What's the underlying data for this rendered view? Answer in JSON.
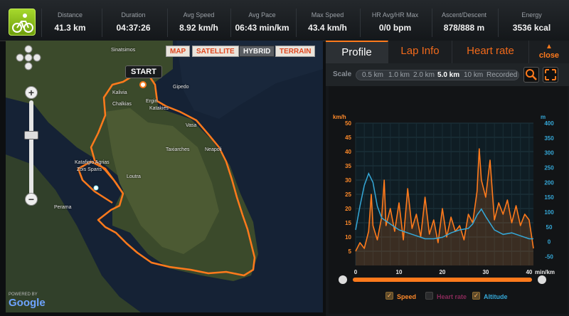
{
  "stats": [
    {
      "label": "Distance",
      "value": "41.3 km"
    },
    {
      "label": "Duration",
      "value": "04:37:26"
    },
    {
      "label": "Avg Speed",
      "value": "8.92 km/h"
    },
    {
      "label": "Avg Pace",
      "value": "06:43 min/km"
    },
    {
      "label": "Max Speed",
      "value": "43.4 km/h"
    },
    {
      "label": "HR Avg/HR Max",
      "value": "0/0 bpm"
    },
    {
      "label": "Ascent/Descent",
      "value": "878/888 m"
    },
    {
      "label": "Energy",
      "value": "3536 kcal"
    }
  ],
  "map": {
    "types": [
      "MAP",
      "SATELLITE",
      "HYBRID",
      "TERRAIN"
    ],
    "selected_type": "HYBRID",
    "start_label": "START",
    "place_labels": [
      "Sinatsimos",
      "Kalivia",
      "Chalkias",
      "Gipedo",
      "Ergin",
      "Katakies",
      "Vasa",
      "Taxiarches",
      "Neapoli",
      "Katafigio Agrias",
      "Zois Sparis",
      "Loutra",
      "Perama"
    ],
    "powered_by": "POWERED BY",
    "logo": "Google",
    "route_color": "#ff7a1c"
  },
  "panel": {
    "tabs": [
      "Profile",
      "Lap Info",
      "Heart rate"
    ],
    "active_tab": "Profile",
    "close_label": "close",
    "scale_label": "Scale",
    "scale_options": [
      "0.5 km",
      "1.0 km",
      "2.0 km",
      "5.0 km",
      "10 km",
      "Recorded"
    ],
    "selected_scale": "5.0 km",
    "zoom_icon": "magnifier-icon",
    "fullscreen_icon": "expand-icon"
  },
  "chart_data": {
    "type": "line",
    "x_unit": "min/km",
    "x_ticks": [
      0,
      10,
      20,
      30,
      40
    ],
    "xlim": [
      0,
      41
    ],
    "y_left": {
      "unit": "km/h",
      "ticks": [
        5,
        10,
        15,
        20,
        25,
        30,
        35,
        40,
        45,
        50
      ],
      "ylim": [
        0,
        50
      ]
    },
    "y_right": {
      "unit": "m",
      "ticks": [
        -50,
        0,
        50,
        100,
        150,
        200,
        250,
        300,
        350,
        400
      ],
      "ylim": [
        -80,
        400
      ]
    },
    "series": [
      {
        "name": "Speed",
        "axis": "left",
        "color": "#ff7a1c",
        "x": [
          0,
          1,
          2,
          3,
          3.6,
          4,
          5,
          6,
          6.6,
          7,
          8,
          9,
          10,
          11,
          12,
          13,
          14,
          15,
          16,
          17,
          18,
          19,
          20,
          21,
          22,
          23,
          24,
          25,
          26,
          27,
          28,
          28.5,
          29,
          30,
          31,
          32,
          33,
          34,
          35,
          36,
          37,
          38,
          39,
          40,
          41
        ],
        "values": [
          5,
          8,
          6,
          12,
          25,
          14,
          9,
          17,
          30,
          14,
          20,
          12,
          22,
          9,
          27,
          13,
          18,
          10,
          24,
          11,
          16,
          8,
          20,
          10,
          17,
          12,
          14,
          9,
          18,
          15,
          26,
          41,
          30,
          24,
          37,
          16,
          22,
          18,
          23,
          15,
          21,
          14,
          18,
          16,
          6
        ]
      },
      {
        "name": "Heart rate",
        "axis": "left",
        "color": "#8a2a5a",
        "values": []
      },
      {
        "name": "Altitude",
        "axis": "right",
        "color": "#35a8d8",
        "x": [
          0,
          1,
          2,
          3,
          4,
          5,
          6,
          7,
          8,
          10,
          12,
          14,
          16,
          18,
          20,
          22,
          24,
          26,
          27,
          28,
          29,
          30,
          32,
          34,
          36,
          38,
          40,
          41
        ],
        "values": [
          40,
          120,
          190,
          230,
          200,
          120,
          80,
          70,
          60,
          40,
          30,
          20,
          10,
          10,
          15,
          30,
          40,
          45,
          60,
          90,
          110,
          85,
          40,
          25,
          30,
          20,
          10,
          10
        ]
      }
    ],
    "legend": [
      "Speed",
      "Heart rate",
      "Altitude"
    ],
    "legend_checked": [
      true,
      false,
      true
    ]
  }
}
